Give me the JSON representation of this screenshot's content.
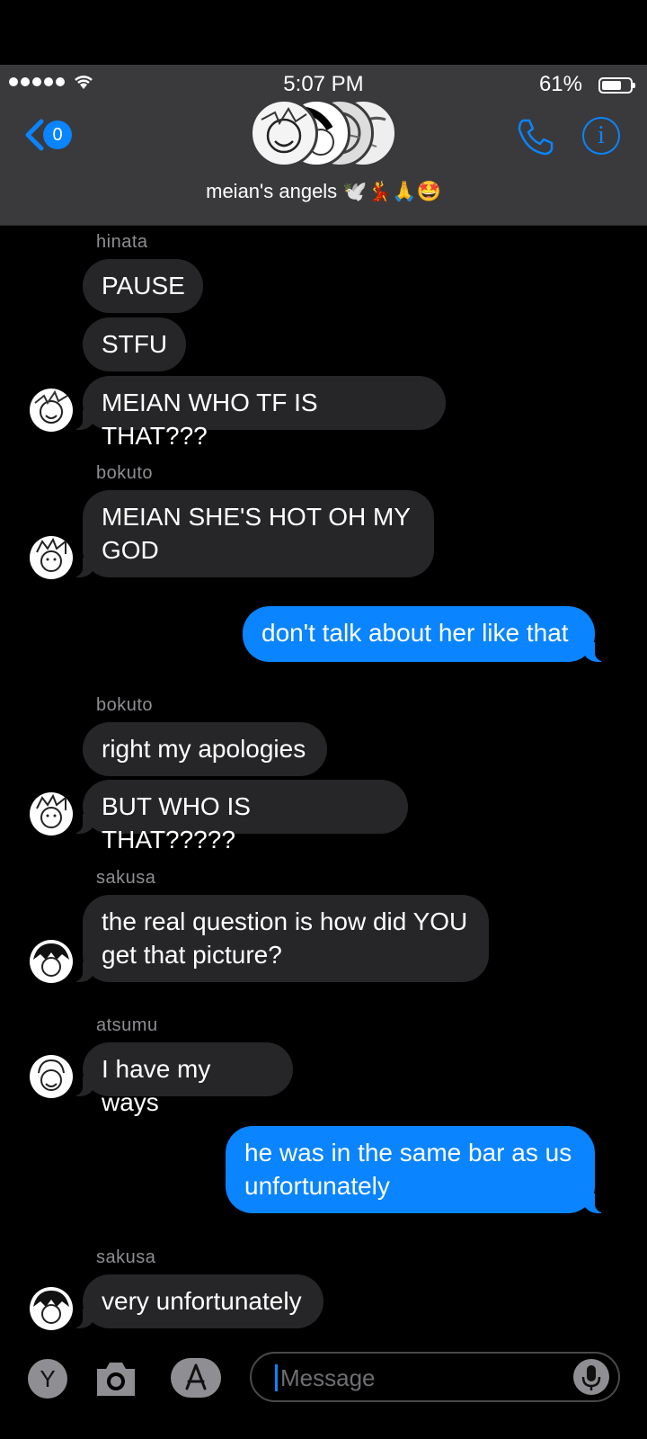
{
  "status_bar": {
    "time": "5:07 PM",
    "battery": "61%"
  },
  "header": {
    "back_count": "0",
    "group_name": "meian's angels 🕊️💃🙏🤩"
  },
  "messages": [
    {
      "sender": "hinata",
      "text": "PAUSE"
    },
    {
      "text": "STFU"
    },
    {
      "text": "MEIAN WHO TF IS THAT???"
    },
    {
      "sender": "bokuto",
      "text": "MEIAN SHE'S HOT OH MY GOD"
    },
    {
      "text": "don't talk about her like that"
    },
    {
      "sender": "bokuto",
      "text": "right my apologies"
    },
    {
      "text": "BUT WHO IS THAT?????"
    },
    {
      "sender": "sakusa",
      "text": "the real question is how did YOU get that picture?"
    },
    {
      "sender": "atsumu",
      "text": "I have my ways"
    },
    {
      "text": "he was in the same bar as us unfortunately"
    },
    {
      "sender": "sakusa",
      "text": "very unfortunately"
    }
  ],
  "input": {
    "placeholder": "Message",
    "y_button": "Y"
  },
  "colors": {
    "accent": "#0a84ff",
    "incoming": "#262628",
    "header": "#3a3a3c"
  }
}
